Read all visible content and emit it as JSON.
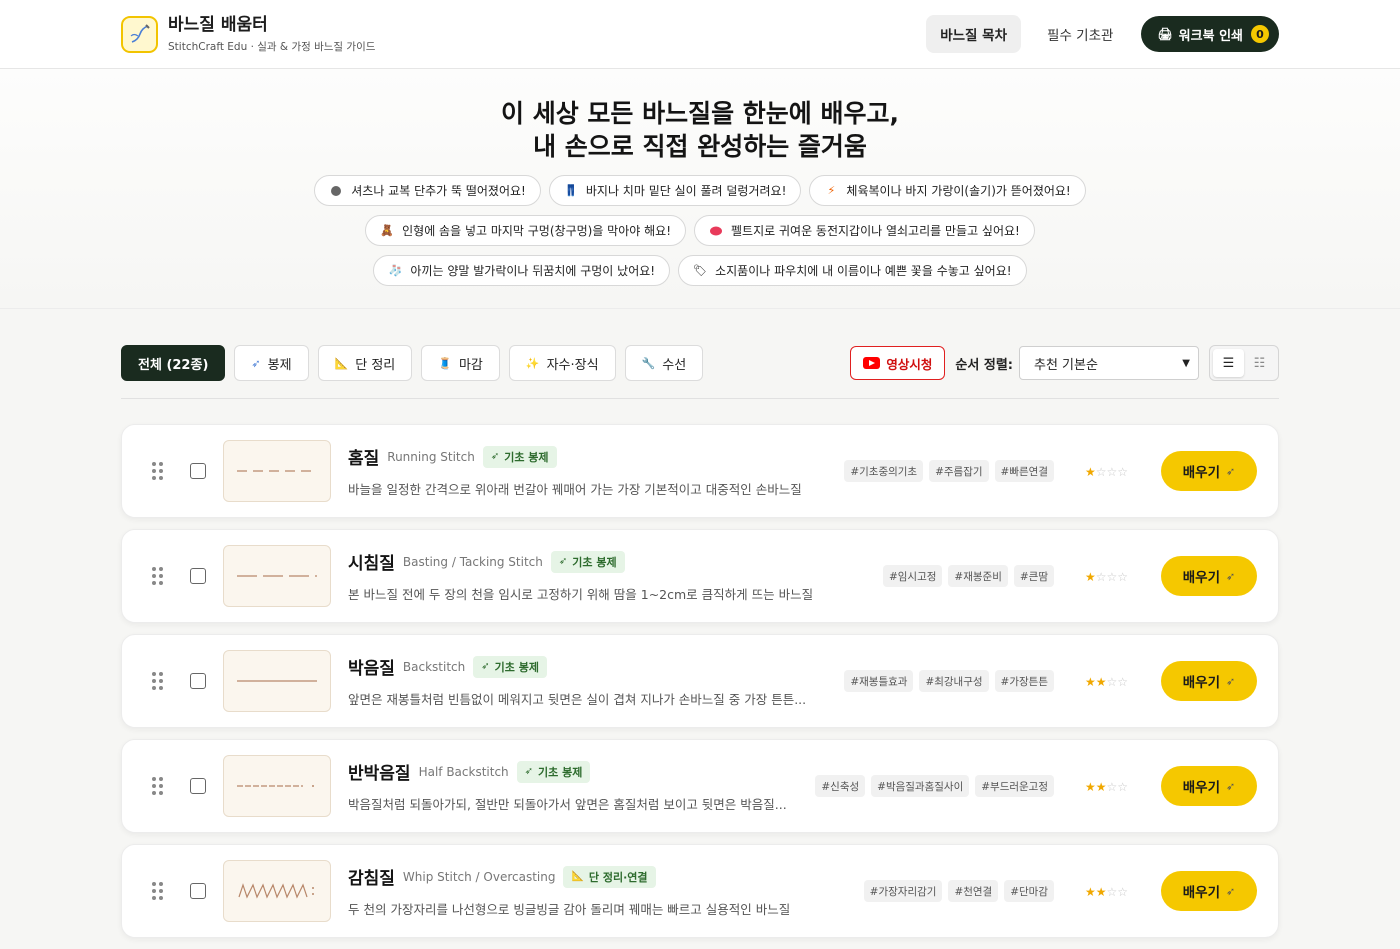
{
  "header": {
    "title": "바느질 배움터",
    "subtitle": "StitchCraft Edu · 실과 & 가정 바느질 가이드",
    "nav": [
      {
        "label": "바느질 목차"
      },
      {
        "label": "필수 기초관"
      }
    ],
    "print_label": "워크북 인쇄",
    "print_count": "0"
  },
  "hero": {
    "title_line1": "이 세상 모든 바느질을 한눈에 배우고,",
    "title_line2": "내 손으로 직접 완성하는 즐거움",
    "chips": [
      [
        "셔츠나 교복 단추가 뚝 떨어졌어요!",
        "바지나 치마 밑단 실이 풀려 덜렁거려요!",
        "체육복이나 바지 가랑이(솔기)가 뜯어졌어요!"
      ],
      [
        "인형에 솜을 넣고 마지막 구멍(창구멍)을 막아야 해요!",
        "펠트지로 귀여운 동전지갑이나 열쇠고리를 만들고 싶어요!"
      ],
      [
        "아끼는 양말 발가락이나 뒤꿈치에 구멍이 났어요!",
        "소지품이나 파우치에 내 이름이나 예쁜 꽃을 수놓고 싶어요!"
      ]
    ]
  },
  "filters": {
    "tabs": [
      "전체 (22종)",
      "봉제",
      "단 정리",
      "마감",
      "자수·장식",
      "수선"
    ],
    "video_label": "영상시청",
    "sort_label": "순서 정렬:",
    "sort_value": "추천 기본순",
    "view_list_icon": "☰",
    "view_grid_icon": "☷"
  },
  "stitches": [
    {
      "name": "홈질",
      "en": "Running Stitch",
      "badge": "기초 봉제",
      "desc": "바늘을 일정한 간격으로 위아래 번갈아 꿰매어 가는 가장 기본적이고 대중적인 손바느질",
      "tags": [
        "#기초중의기초",
        "#주름잡기",
        "#빠른연결"
      ],
      "difficulty": 1,
      "learn_label": "배우기"
    },
    {
      "name": "시침질",
      "en": "Basting / Tacking Stitch",
      "badge": "기초 봉제",
      "desc": "본 바느질 전에 두 장의 천을 임시로 고정하기 위해 땀을 1~2cm로 큼직하게 뜨는 바느질",
      "tags": [
        "#임시고정",
        "#재봉준비",
        "#큰땀"
      ],
      "difficulty": 1,
      "learn_label": "배우기"
    },
    {
      "name": "박음질",
      "en": "Backstitch",
      "badge": "기초 봉제",
      "desc": "앞면은 재봉틀처럼 빈틈없이 메워지고 뒷면은 실이 겹쳐 지나가 손바느질 중 가장 튼튼...",
      "tags": [
        "#재봉틀효과",
        "#최강내구성",
        "#가장튼튼"
      ],
      "difficulty": 2,
      "learn_label": "배우기"
    },
    {
      "name": "반박음질",
      "en": "Half Backstitch",
      "badge": "기초 봉제",
      "desc": "박음질처럼 되돌아가되, 절반만 되돌아가서 앞면은 홈질처럼 보이고 뒷면은 박음질...",
      "tags": [
        "#신축성",
        "#박음질과홈질사이",
        "#부드러운고정"
      ],
      "difficulty": 2,
      "learn_label": "배우기"
    },
    {
      "name": "감침질",
      "en": "Whip Stitch / Overcasting",
      "badge": "단 정리·연결",
      "desc": "두 천의 가장자리를 나선형으로 빙글빙글 감아 돌리며 꿰매는 빠르고 실용적인 바느질",
      "tags": [
        "#가장자리감기",
        "#천연결",
        "#단마감"
      ],
      "difficulty": 2,
      "learn_label": "배우기"
    }
  ]
}
